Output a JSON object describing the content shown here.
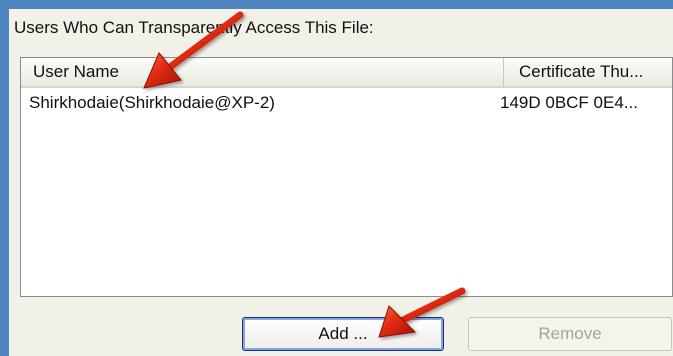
{
  "section": {
    "label": "Users Who Can Transparently Access This File:"
  },
  "table": {
    "columns": [
      "User Name",
      "Certificate Thu..."
    ],
    "rows": [
      {
        "user_name": "Shirkhodaie(Shirkhodaie@XP-2)",
        "certificate": "149D 0BCF 0E4..."
      }
    ]
  },
  "buttons": {
    "add": "Add ...",
    "remove": "Remove",
    "remove_disabled": true
  },
  "colors": {
    "window_border": "#4f86c2",
    "panel": "#f2f1e8",
    "annotation_arrow": "#d62812"
  },
  "annotations": [
    "arrow-icon",
    "arrow-icon"
  ]
}
